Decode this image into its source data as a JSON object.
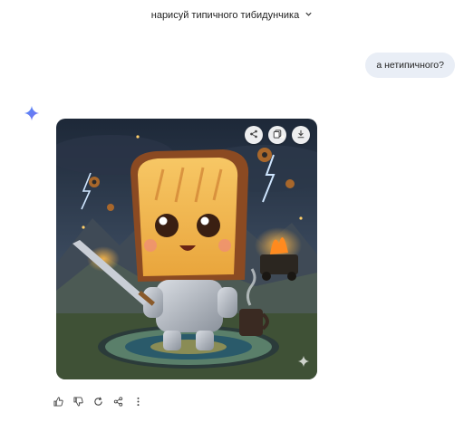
{
  "header": {
    "title": "нарисуй типичного тибидунчика",
    "dropdown_icon": "chevron-down-icon"
  },
  "conversation": {
    "user_message": "а нетипичного?",
    "assistant_icon": "sparkle-icon"
  },
  "image_actions": [
    "share-icon",
    "copy-icon",
    "download-icon"
  ],
  "response_actions": [
    "thumb-up-icon",
    "thumb-down-icon",
    "regenerate-icon",
    "share-icon",
    "more-vert-icon"
  ],
  "colors": {
    "accent": "#4285f4",
    "bubble": "#e9eef6"
  }
}
